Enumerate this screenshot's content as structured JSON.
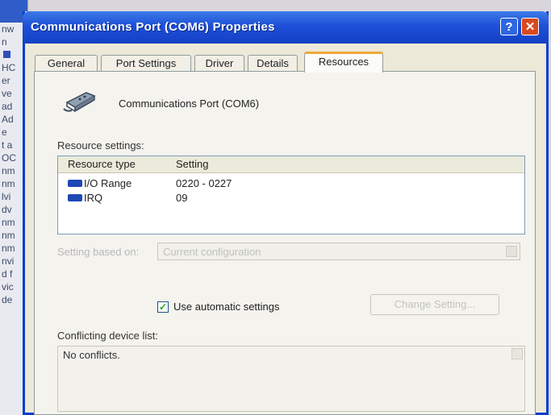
{
  "background_window": {
    "lines": [
      "nw",
      "n",
      "",
      "HC",
      "er",
      "ve",
      "ad",
      "Ad",
      "e",
      "t a",
      "OC",
      "nm",
      "nm",
      "lvi",
      "dv",
      "nm",
      "nm",
      "nm",
      "nvi",
      "d f",
      "vic",
      "de"
    ]
  },
  "window": {
    "title": "Communications Port (COM6) Properties",
    "help_label": "?",
    "close_label": "✕"
  },
  "tabs": [
    {
      "label": "General"
    },
    {
      "label": "Port Settings"
    },
    {
      "label": "Driver"
    },
    {
      "label": "Details"
    },
    {
      "label": "Resources"
    }
  ],
  "active_tab": "Resources",
  "device": {
    "icon": "port-connector-icon",
    "name": "Communications Port (COM6)"
  },
  "resource_settings": {
    "label": "Resource settings:",
    "columns": [
      "Resource type",
      "Setting"
    ],
    "rows": [
      {
        "icon": "resource-icon",
        "type": "I/O Range",
        "setting": "0220 - 0227"
      },
      {
        "icon": "resource-icon",
        "type": "IRQ",
        "setting": "09"
      }
    ]
  },
  "setting_based_on": {
    "label": "Setting based on:",
    "value": "Current configuration"
  },
  "auto_settings": {
    "label": "Use automatic settings",
    "checked": true
  },
  "change_setting_button": "Change Setting...",
  "conflicts": {
    "label": "Conflicting device list:",
    "value": "No conflicts."
  },
  "colors": {
    "titlebar": "#1d4fd8",
    "active_tab_accent": "#f0a93a",
    "close_button": "#d9491e"
  }
}
